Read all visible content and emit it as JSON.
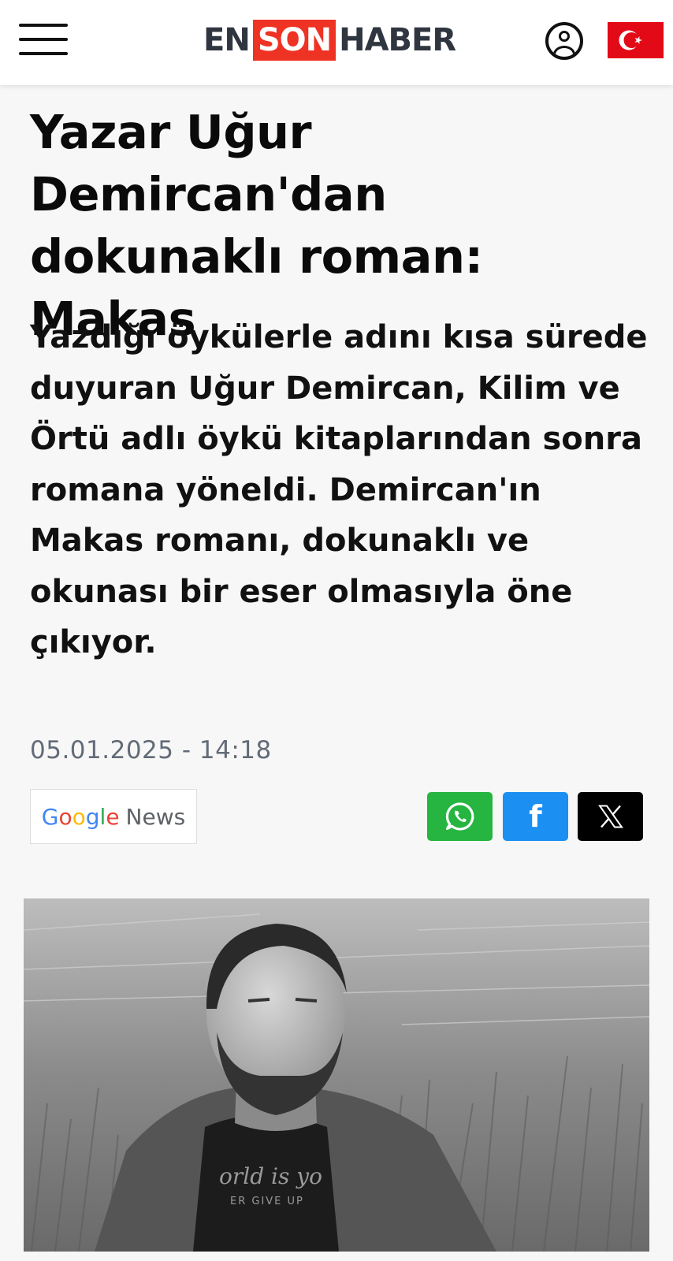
{
  "header": {
    "logo": {
      "en": "EN",
      "son": "SON",
      "haber": "HABER"
    },
    "menu_icon": "hamburger-menu-icon",
    "user_icon": "user-account-icon",
    "flag_icon": "turkey-flag-icon"
  },
  "article": {
    "title": "Yazar Uğur Demircan'dan dokunaklı roman: Makas",
    "summary": "Yazdığı öykülerle adını kısa sürede duyuran Uğur Demircan, Kilim ve Örtü adlı öykü kitaplarından sonra romana yöneldi. Demircan'ın Makas romanı, dokunaklı ve okunası bir eser olmasıyla öne çıkıyor.",
    "date": "05.01.2025 - 14:18"
  },
  "google_news": {
    "google": [
      "G",
      "o",
      "o",
      "g",
      "l",
      "e"
    ],
    "news": "News"
  },
  "share": {
    "whatsapp_icon": "whatsapp-icon",
    "facebook_icon": "facebook-icon",
    "facebook_label": "f",
    "x_icon": "x-twitter-icon"
  },
  "image": {
    "photo_text": [
      "orld is yo",
      "ER GIVE UP"
    ]
  },
  "colors": {
    "brand_red": "#ee3324",
    "logo_dark": "#2f3640",
    "whatsapp": "#25b540",
    "facebook": "#1b8ff2",
    "x": "#000000",
    "date_gray": "#636b78"
  }
}
